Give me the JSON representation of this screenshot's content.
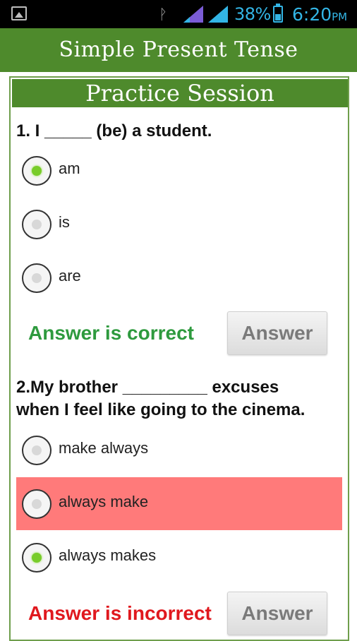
{
  "status_bar": {
    "battery": "38%",
    "time": "6:20",
    "ampm": "PM",
    "accent": "#33b5e5",
    "icons": [
      "image-icon",
      "bluetooth-icon",
      "signal-icon",
      "signal-icon",
      "battery-icon"
    ]
  },
  "app_bar": {
    "title": "Simple Present Tense",
    "color": "#4e8a2c"
  },
  "session": {
    "title": "Practice Session"
  },
  "q1": {
    "text": "1. I _____ (be) a student.",
    "options": [
      "am",
      "is",
      "are"
    ],
    "selected": "am",
    "result": "Answer is correct",
    "button": "Answer"
  },
  "q2": {
    "line1": "2.My brother _________ excuses",
    "line2": "when I feel like going to the cinema.",
    "options": [
      "make always",
      "always make",
      "always makes"
    ],
    "selected": "always makes",
    "highlighted_wrong": "always make",
    "result": "Answer is incorrect",
    "button": "Answer"
  }
}
